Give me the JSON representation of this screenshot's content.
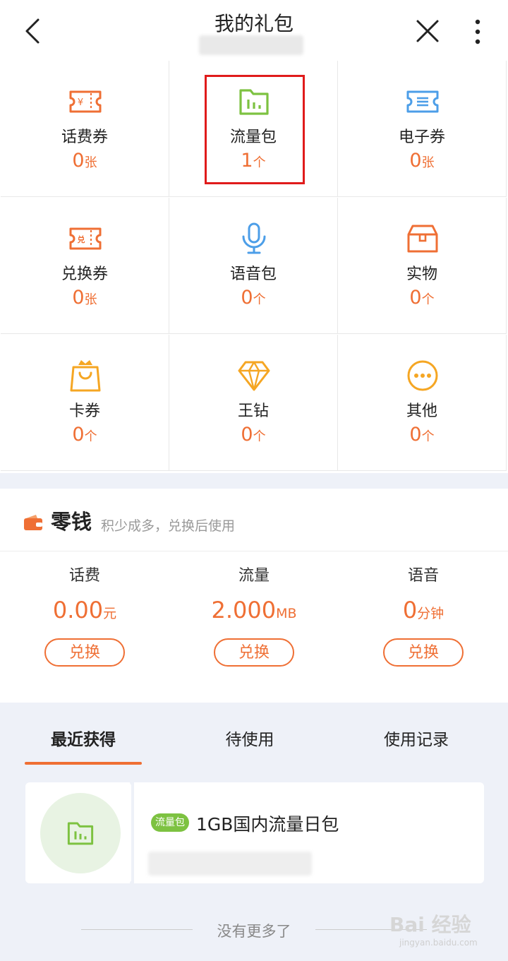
{
  "header": {
    "title": "我的礼包"
  },
  "gifts": [
    {
      "label": "话费券",
      "count": "0",
      "unit": "张",
      "icon": "phone-fee-ticket-icon",
      "color": "#ef6f34"
    },
    {
      "label": "流量包",
      "count": "1",
      "unit": "个",
      "icon": "data-package-icon",
      "color": "#7dc241"
    },
    {
      "label": "电子券",
      "count": "0",
      "unit": "张",
      "icon": "e-coupon-icon",
      "color": "#4c9ee8"
    },
    {
      "label": "兑换券",
      "count": "0",
      "unit": "张",
      "icon": "exchange-ticket-icon",
      "color": "#ef6f34"
    },
    {
      "label": "语音包",
      "count": "0",
      "unit": "个",
      "icon": "microphone-icon",
      "color": "#4c9ee8"
    },
    {
      "label": "实物",
      "count": "0",
      "unit": "个",
      "icon": "box-icon",
      "color": "#ef6f34"
    },
    {
      "label": "卡券",
      "count": "0",
      "unit": "个",
      "icon": "crown-bag-icon",
      "color": "#f5a623"
    },
    {
      "label": "王钻",
      "count": "0",
      "unit": "个",
      "icon": "diamond-icon",
      "color": "#f5a623"
    },
    {
      "label": "其他",
      "count": "0",
      "unit": "个",
      "icon": "more-circle-icon",
      "color": "#f5a623"
    }
  ],
  "change": {
    "title": "零钱",
    "subtitle": "积少成多，兑换后使用",
    "items": [
      {
        "label": "话费",
        "value": "0.00",
        "unit": "元",
        "button": "兑换"
      },
      {
        "label": "流量",
        "value": "2.000",
        "unit": "MB",
        "button": "兑换"
      },
      {
        "label": "语音",
        "value": "0",
        "unit": "分钟",
        "button": "兑换"
      }
    ]
  },
  "tabs": [
    {
      "label": "最近获得",
      "active": true
    },
    {
      "label": "待使用",
      "active": false
    },
    {
      "label": "使用记录",
      "active": false
    }
  ],
  "recent_item": {
    "badge": "流量包",
    "title": "1GB国内流量日包"
  },
  "footer": {
    "no_more": "没有更多了"
  },
  "watermark": {
    "brand": "Bai 经验",
    "url": "jingyan.baidu.com"
  },
  "colors": {
    "accent": "#ef6f34",
    "green": "#7dc241",
    "blue": "#4c9ee8",
    "gold": "#f5a623",
    "highlight_box": "#e01b1b"
  }
}
